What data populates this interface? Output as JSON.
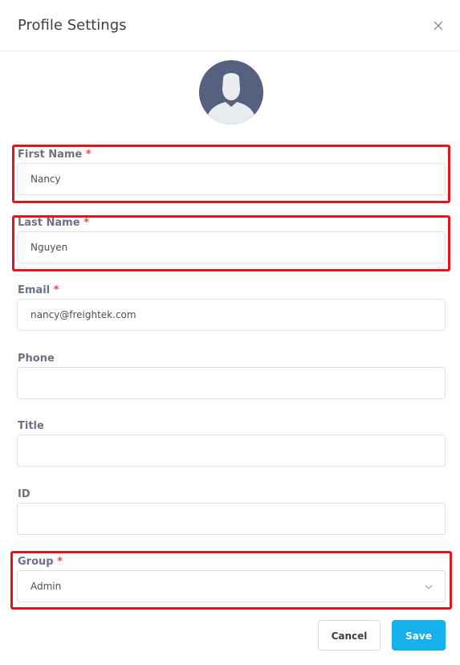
{
  "modal": {
    "title": "Profile Settings",
    "close_icon": "close-icon"
  },
  "avatar": {
    "icon": "user-silhouette-icon"
  },
  "fields": {
    "first_name": {
      "label": "First Name",
      "required_mark": "*",
      "value": "Nancy"
    },
    "last_name": {
      "label": "Last Name",
      "required_mark": "*",
      "value": "Nguyen"
    },
    "email": {
      "label": "Email",
      "required_mark": "*",
      "value": "nancy@freightek.com"
    },
    "phone": {
      "label": "Phone",
      "value": ""
    },
    "title": {
      "label": "Title",
      "value": ""
    },
    "id": {
      "label": "ID",
      "value": ""
    },
    "group": {
      "label": "Group",
      "required_mark": "*",
      "value": "Admin",
      "icon": "chevron-down-icon"
    }
  },
  "buttons": {
    "cancel_label": "Cancel",
    "save_label": "Save"
  },
  "colors": {
    "accent": "#16b1ec",
    "required": "#e74c4c",
    "highlight": "#e3141b",
    "avatar_bg": "#56617f"
  }
}
